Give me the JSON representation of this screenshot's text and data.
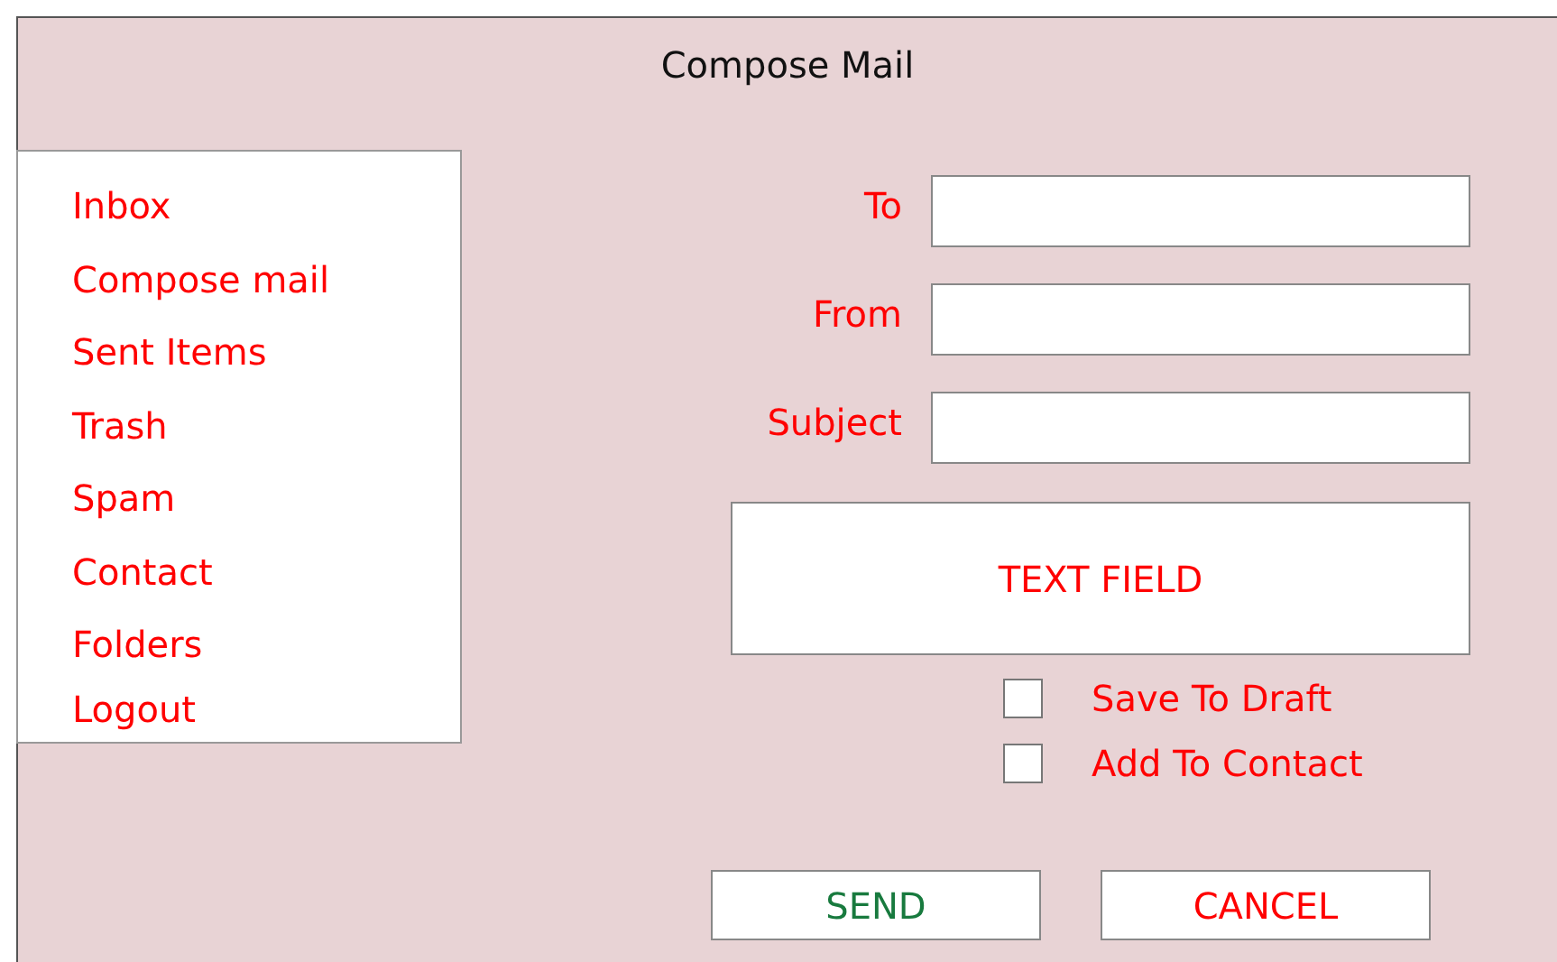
{
  "window": {
    "title": "Compose Mail"
  },
  "sidebar": {
    "items": [
      {
        "label": "Inbox"
      },
      {
        "label": "Compose mail"
      },
      {
        "label": "Sent Items"
      },
      {
        "label": "Trash"
      },
      {
        "label": "Spam"
      },
      {
        "label": "Contact"
      },
      {
        "label": "Folders"
      },
      {
        "label": "Logout"
      }
    ]
  },
  "fields": [
    {
      "label": "To"
    },
    {
      "label": "From"
    },
    {
      "label": "Subject"
    }
  ],
  "message": {
    "placeholder": "TEXT FIELD"
  },
  "options": [
    {
      "label": "Save To Draft",
      "checked": false
    },
    {
      "label": "Add To Contact",
      "checked": false
    }
  ],
  "buttons": [
    {
      "label": "SEND",
      "color": "#187a3e"
    },
    {
      "label": "CANCEL",
      "color": "#ff0000"
    }
  ]
}
